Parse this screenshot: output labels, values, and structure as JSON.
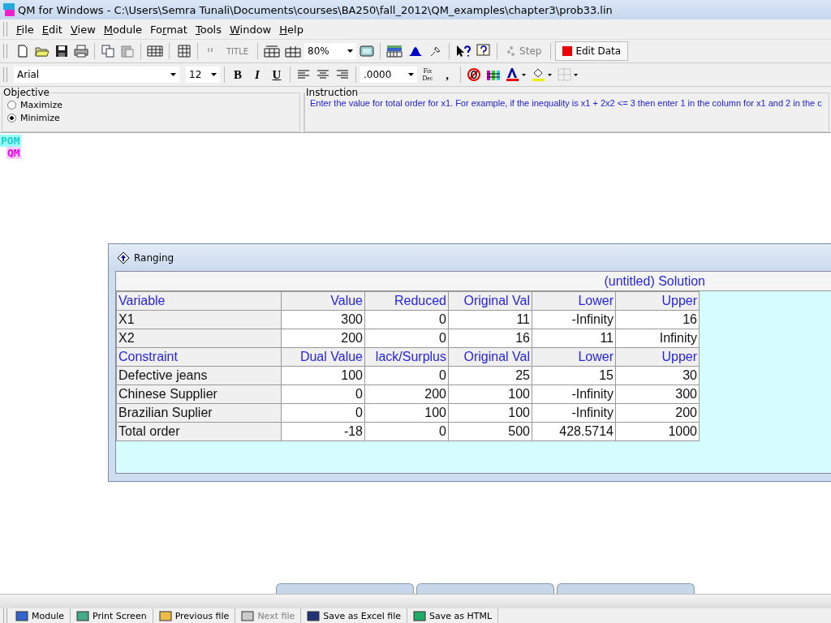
{
  "window": {
    "title": "QM for Windows - C:\\Users\\Semra Tunali\\Documents\\courses\\BA250\\fall_2012\\QM_examples\\chapter3\\prob33.lin"
  },
  "menu": [
    {
      "key": "F",
      "rest": "ile"
    },
    {
      "key": "E",
      "rest": "dit"
    },
    {
      "key": "V",
      "rest": "iew"
    },
    {
      "key": "M",
      "rest": "odule"
    },
    {
      "pre": "Fo",
      "key": "r",
      "rest": "mat"
    },
    {
      "key": "T",
      "rest": "ools"
    },
    {
      "key": "W",
      "rest": "indow"
    },
    {
      "key": "H",
      "rest": "elp"
    }
  ],
  "toolbar": {
    "title_button": {
      "label": "TITLE",
      "disabled": true
    },
    "zoom": "80%",
    "step_button": {
      "label": "Step",
      "disabled": true
    },
    "edit_button": {
      "label": "Edit Data"
    }
  },
  "format_bar": {
    "font": "Arial",
    "size": "12",
    "number_format": ".0000",
    "style_buttons": [
      "B",
      "I",
      "U"
    ],
    "fix_dec": [
      "Fix",
      "Dec"
    ],
    "comma": ","
  },
  "objective": {
    "title": "Objective",
    "options": [
      {
        "label": "Maximize",
        "selected": false
      },
      {
        "label": "Minimize",
        "selected": true
      }
    ]
  },
  "instruction": {
    "title": "Instruction",
    "text": "Enter the value for total order for x1. For example, if the inequality is x1 + 2x2 <= 3 then enter 1 in the column for x1 and 2 in the c"
  },
  "logo": [
    "POM",
    "QM"
  ],
  "ranging": {
    "title": "Ranging",
    "solution_title": "(untitled) Solution",
    "rows": [
      {
        "kind": "header",
        "cells": [
          "Variable",
          "Value",
          "Reduced",
          "Original Val",
          "Lower",
          "Upper"
        ]
      },
      {
        "kind": "data",
        "cells": [
          "X1",
          "300",
          "0",
          "11",
          "-Infinity",
          "16"
        ]
      },
      {
        "kind": "data",
        "cells": [
          "X2",
          "200",
          "0",
          "16",
          "11",
          "Infinity"
        ]
      },
      {
        "kind": "header",
        "cells": [
          "Constraint",
          "Dual Value",
          "lack/Surplus",
          "Original Val",
          "Lower",
          "Upper"
        ]
      },
      {
        "kind": "data",
        "cells": [
          "Defective jeans",
          "100",
          "0",
          "25",
          "15",
          "30"
        ]
      },
      {
        "kind": "data",
        "cells": [
          "Chinese Supplier",
          "0",
          "200",
          "100",
          "-Infinity",
          "300"
        ]
      },
      {
        "kind": "data",
        "cells": [
          "Brazilian Suplier",
          "0",
          "100",
          "100",
          "-Infinity",
          "200"
        ]
      },
      {
        "kind": "data",
        "cells": [
          "Total order",
          "-18",
          "0",
          "500",
          "428.5714",
          "1000"
        ]
      }
    ]
  },
  "bottom_bar": [
    {
      "label": "Module",
      "disabled": false
    },
    {
      "label": "Print Screen",
      "disabled": false
    },
    {
      "label": "Previous file",
      "disabled": false
    },
    {
      "label": "Next file",
      "disabled": true
    },
    {
      "label": "Save as Excel file",
      "disabled": false
    },
    {
      "label": "Save as HTML",
      "disabled": false
    }
  ]
}
